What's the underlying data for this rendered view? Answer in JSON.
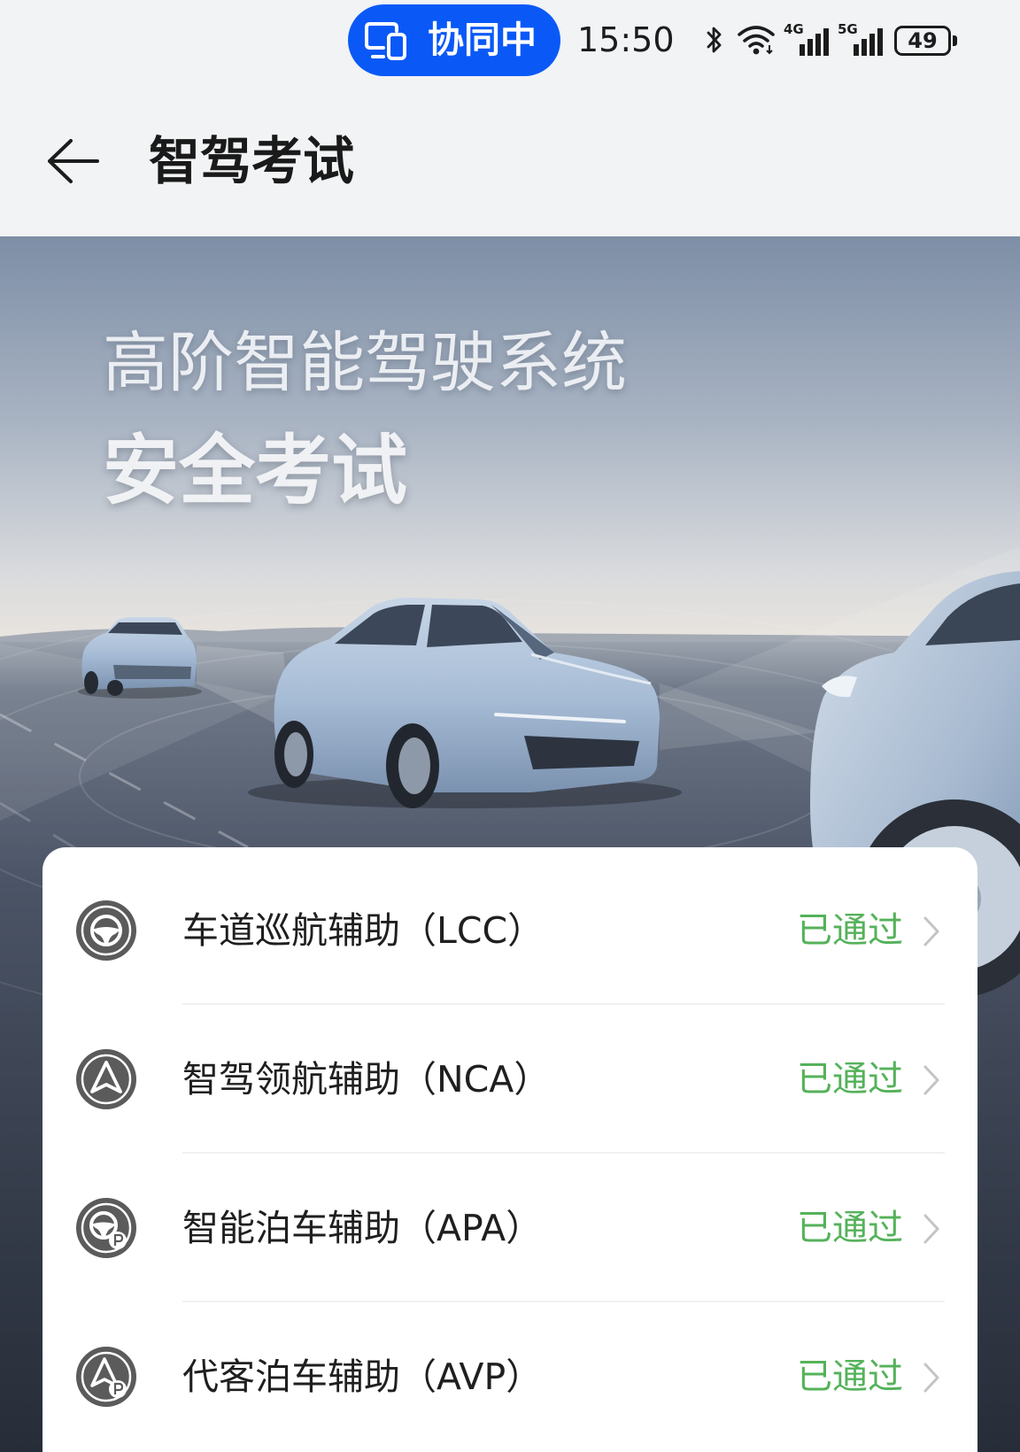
{
  "status_bar": {
    "collab_label": "协同中",
    "time": "15:50",
    "signal_1_type": "4G",
    "signal_2_type": "5G",
    "battery_level": "49",
    "icons": [
      "screen-share-icon",
      "bluetooth-icon",
      "wifi-icon",
      "cellular-signal-icon",
      "cellular-signal-icon",
      "battery-icon"
    ]
  },
  "header": {
    "back_icon": "back-arrow-icon",
    "title": "智驾考试"
  },
  "banner": {
    "headline": "高阶智能驾驶系统",
    "subheadline": "安全考试"
  },
  "exams": [
    {
      "name": "车道巡航辅助（LCC）",
      "status": "已通过",
      "icon": "steering-wheel-icon"
    },
    {
      "name": "智驾领航辅助（NCA）",
      "status": "已通过",
      "icon": "navigation-arrow-icon"
    },
    {
      "name": "智能泊车辅助（APA）",
      "status": "已通过",
      "icon": "parking-steering-wheel-icon"
    },
    {
      "name": "代客泊车辅助（AVP）",
      "status": "已通过",
      "icon": "valet-parking-icon"
    }
  ],
  "colors": {
    "collab_pill": "#0a59f7",
    "status_passed": "#55b25a",
    "header_bg": "#f1f3f5",
    "card_bg": "#ffffff",
    "exam_icon": "#5b5b5b"
  }
}
